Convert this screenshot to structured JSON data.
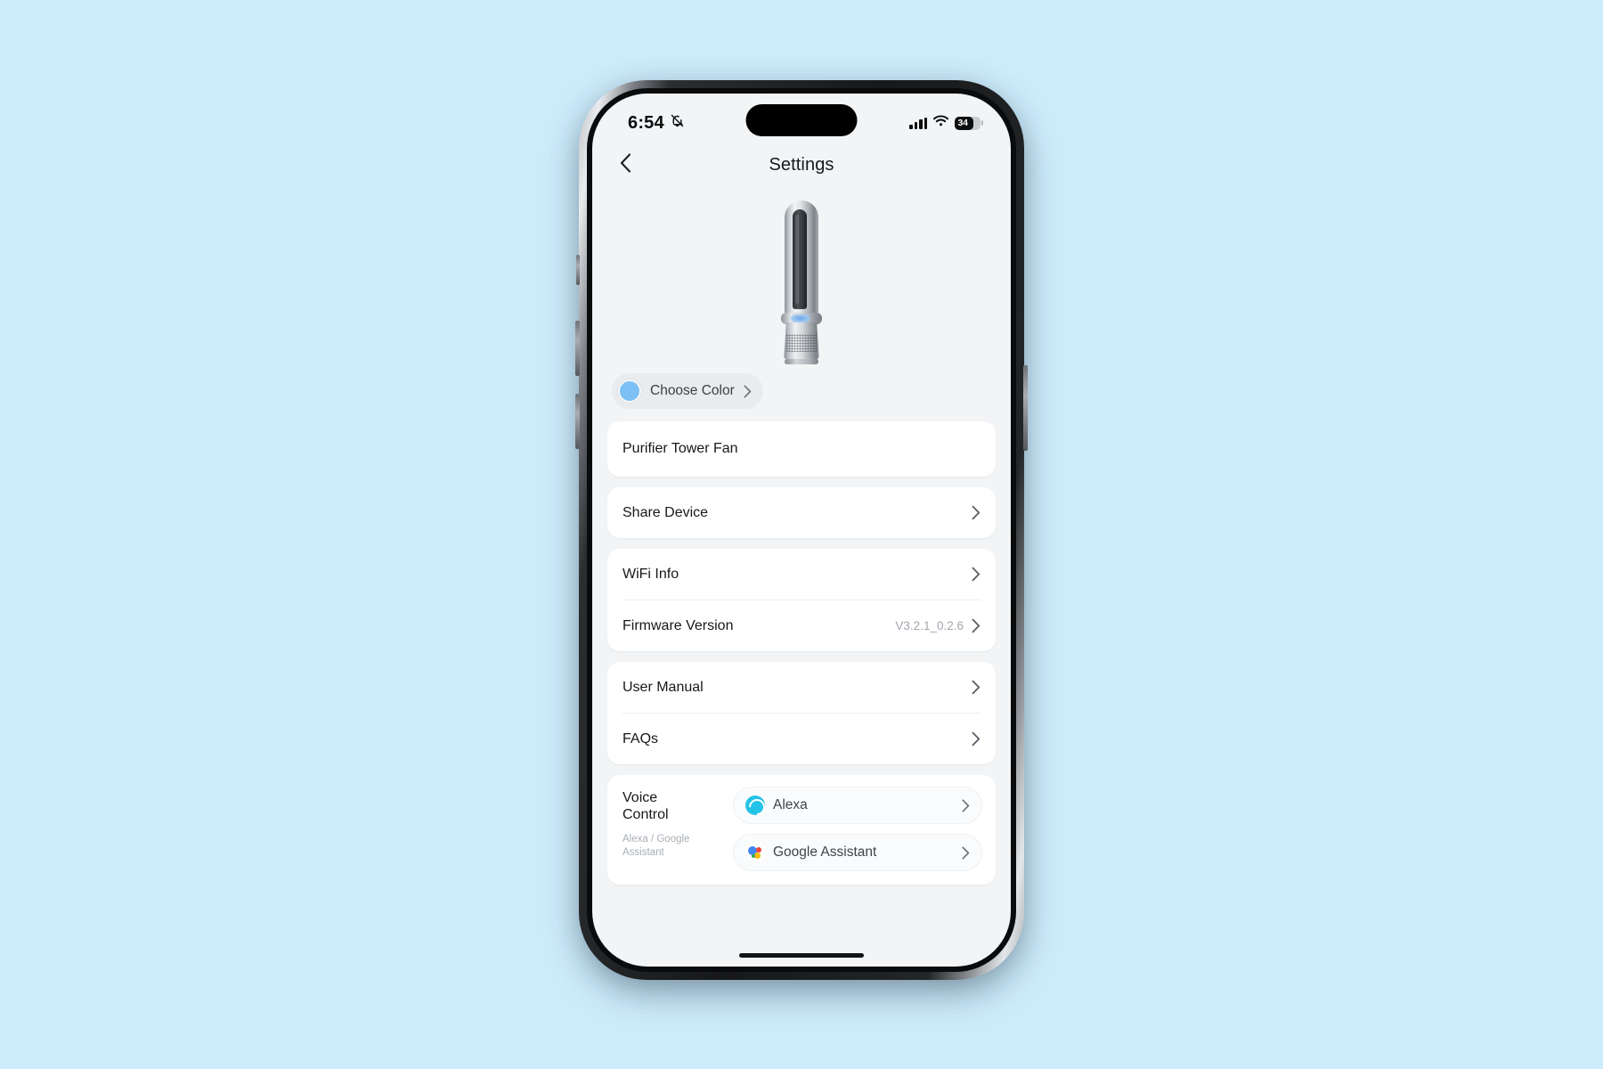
{
  "status_bar": {
    "time": "6:54",
    "silent_icon": "bell-slash-icon",
    "cellular_icon": "cellular-bars-icon",
    "wifi_icon": "wifi-icon",
    "battery_percent": "34"
  },
  "nav": {
    "back_icon": "chevron-left-icon",
    "title": "Settings"
  },
  "hero": {
    "product_image_name": "purifier-tower-fan-product-image"
  },
  "color_selector": {
    "label": "Choose Color",
    "swatch_color": "#7cc0f5",
    "chevron": "chevron-right-icon"
  },
  "device_name": {
    "value": "Purifier Tower Fan"
  },
  "share": {
    "label": "Share Device"
  },
  "info_group": [
    {
      "label": "WiFi Info",
      "value": ""
    },
    {
      "label": "Firmware Version",
      "value": "V3.2.1_0.2.6"
    }
  ],
  "help_group": [
    {
      "label": "User Manual",
      "value": ""
    },
    {
      "label": "FAQs",
      "value": ""
    }
  ],
  "voice_control": {
    "title": "Voice Control",
    "subtitle": "Alexa / Google Assistant",
    "options": [
      {
        "name": "Alexa",
        "icon": "alexa-icon",
        "color": "#23c3e8"
      },
      {
        "name": "Google Assistant",
        "icon": "google-assistant-icon",
        "color": "#4285f4"
      }
    ]
  },
  "theme": {
    "page_background": "#cdecfb",
    "screen_background": "#f2f4f6",
    "card_background": "#ffffff",
    "text_primary": "#16181a",
    "text_muted": "#a2a8af"
  }
}
